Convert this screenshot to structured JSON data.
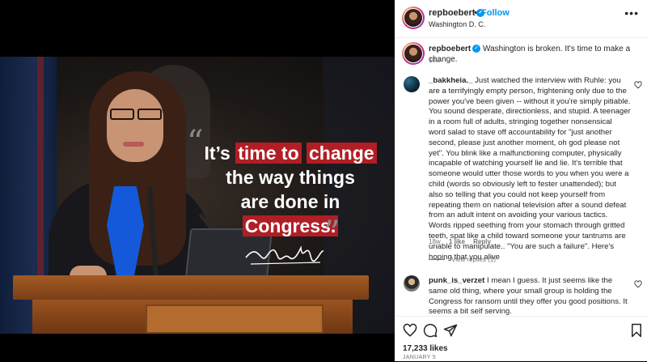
{
  "post": {
    "quote_lines": [
      [
        "It's ",
        "time to",
        " ",
        "change",
        ""
      ],
      [
        "the way things"
      ],
      [
        "are done in"
      ],
      [
        "Congress."
      ]
    ],
    "quote_line1_pre": "It’s ",
    "quote_line1_hl1": "time to",
    "quote_line1_hl2": "change",
    "quote_line2": "the way things",
    "quote_line3": "are done in",
    "quote_line4": "Congress.",
    "signature_alt": "Lauren B"
  },
  "header": {
    "username": "repboebert",
    "separator": "•",
    "follow_label": "Follow",
    "location": "Washington D. C.",
    "more_label": "•••"
  },
  "caption": {
    "username": "repboebert",
    "text": "Washington is broken. It's time to make a change.",
    "time": "18w"
  },
  "comments": [
    {
      "username": "_bakkheia._",
      "text": "Just watched the interview with Ruhle: you are a terrifyingly empty person, frightening only due to the power you've been given -- without it you're simply pitiable. You sound desperate, directionless, and stupid. A teenager in a room full of adults, stringing together nonsensical word salad to stave off accountability for \"just another second, please just another moment, oh god please not yet\". You blink like a malfunctioning computer, physically incapable of watching yourself lie and lie. It's terrible that someone would utter those words to you when you were a child (words so obviously left to fester unattended); but also so telling that you could not keep yourself from repeating them on national television after a sound defeat from an adult intent on avoiding your various tactics. Words ripped seething from your stomach through gritted teeth, spat like a child toward someone your tantrums are unable to manipulate.. \"You are such a failure\". Here's hoping that you alive",
      "time": "18w",
      "likes": "1 like",
      "reply": "Reply",
      "view_replies": "View replies (1)"
    },
    {
      "username": "punk_is_verzet",
      "text": "I mean I guess. It just seems like the same old thing, where your small group is holding the Congress for ransom until they offer you good positions. It seems a bit self serving."
    }
  ],
  "footer": {
    "likes": "17,233 likes",
    "date": "JANUARY 5"
  },
  "colors": {
    "accent": "#0095f6",
    "highlight": "#b11e25",
    "text": "#262626",
    "muted": "#737373"
  },
  "icons": [
    "heart-icon",
    "comment-icon",
    "share-icon",
    "bookmark-icon",
    "more-icon",
    "verified-icon"
  ]
}
